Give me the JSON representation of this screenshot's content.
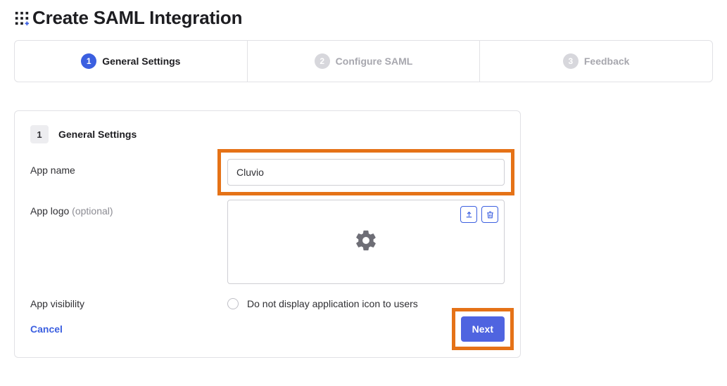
{
  "page": {
    "title": "Create SAML Integration"
  },
  "wizard": {
    "steps": [
      {
        "num": "1",
        "label": "General Settings",
        "active": true
      },
      {
        "num": "2",
        "label": "Configure SAML",
        "active": false
      },
      {
        "num": "3",
        "label": "Feedback",
        "active": false
      }
    ]
  },
  "panel": {
    "step_num": "1",
    "title": "General Settings",
    "app_name_label": "App name",
    "app_name_value": "Cluvio",
    "app_logo_label": "App logo ",
    "app_logo_optional": "(optional)",
    "visibility_label": "App visibility",
    "visibility_checkbox_label": "Do not display application icon to users",
    "cancel": "Cancel",
    "next": "Next"
  }
}
